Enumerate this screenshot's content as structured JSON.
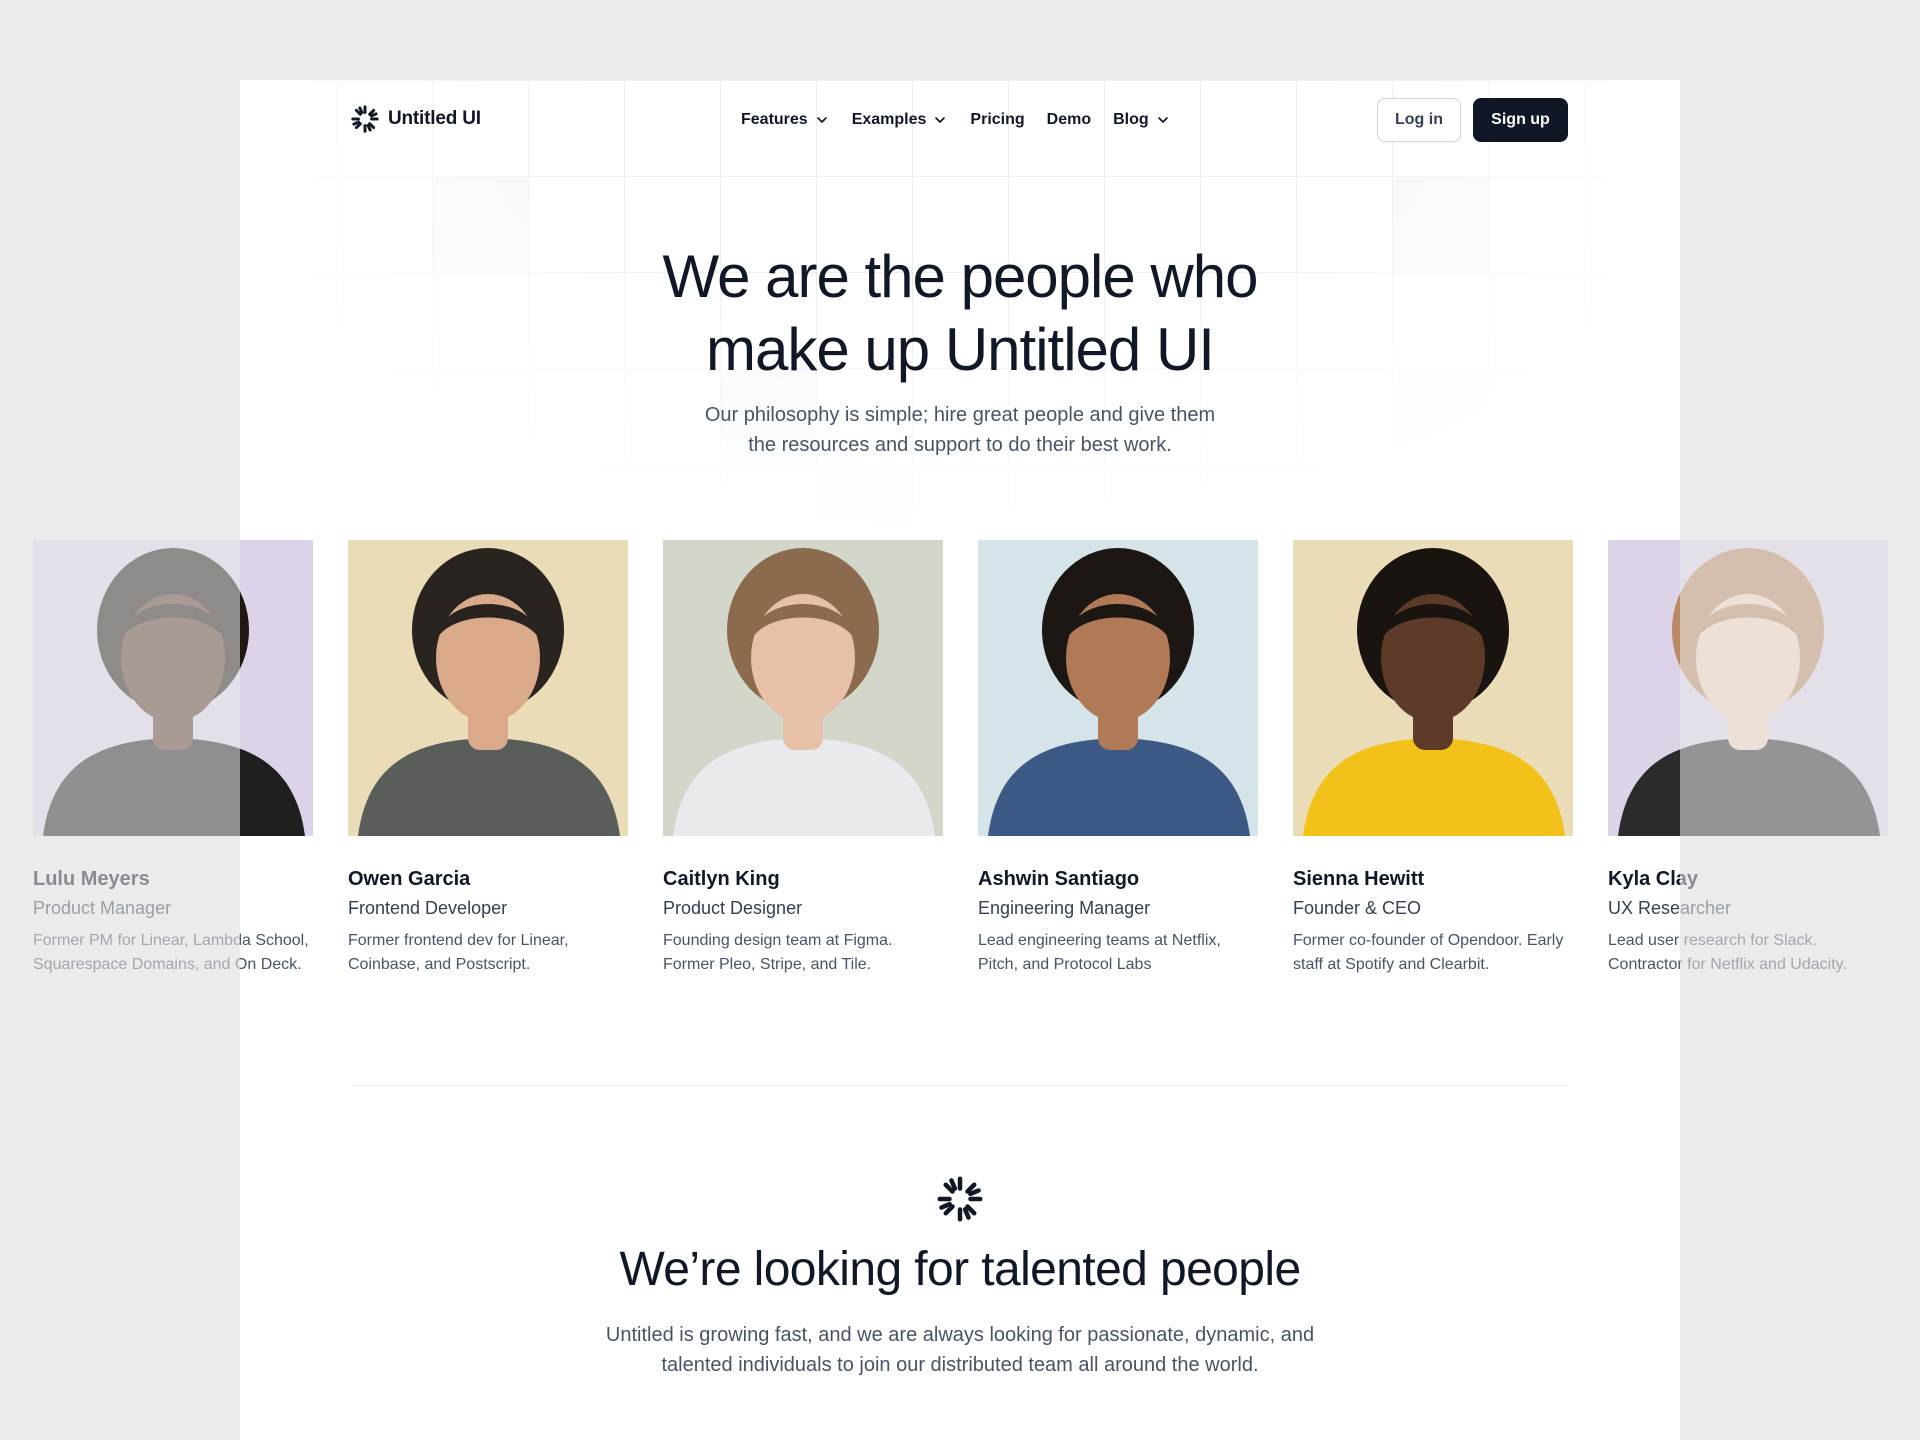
{
  "brand": {
    "name": "Untitled UI"
  },
  "nav": {
    "items": [
      {
        "label": "Features",
        "has_dropdown": true
      },
      {
        "label": "Examples",
        "has_dropdown": true
      },
      {
        "label": "Pricing",
        "has_dropdown": false
      },
      {
        "label": "Demo",
        "has_dropdown": false
      },
      {
        "label": "Blog",
        "has_dropdown": true
      }
    ],
    "login_label": "Log in",
    "signup_label": "Sign up"
  },
  "hero": {
    "title_line1": "We are the people who",
    "title_line2": "make up Untitled UI",
    "subtitle_line1": "Our philosophy is simple; hire great people and give them",
    "subtitle_line2": "the resources and support to do their best work."
  },
  "team": [
    {
      "name": "Lulu Meyers",
      "role": "Product Manager",
      "bio": "Former PM for Linear, Lambda School, Squarespace Domains, and On Deck.",
      "bg": "#dcd3e8",
      "skin": "#5a3a2a",
      "hair": "#1f1712",
      "shirt": "#1f1f1f"
    },
    {
      "name": "Owen Garcia",
      "role": "Frontend Developer",
      "bio": "Former frontend dev for Linear, Coinbase, and Postscript.",
      "bg": "#ebdcb8",
      "skin": "#d9a98a",
      "hair": "#2a2420",
      "shirt": "#5a5e5a"
    },
    {
      "name": "Caitlyn King",
      "role": "Product Designer",
      "bio": "Founding design team at Figma. Former Pleo, Stripe, and Tile.",
      "bg": "#d3d7c9",
      "skin": "#e6c1a7",
      "hair": "#8b6a4e",
      "shirt": "#e8eaee"
    },
    {
      "name": "Ashwin Santiago",
      "role": "Engineering Manager",
      "bio": "Lead engineering teams at Netflix, Pitch, and Protocol Labs",
      "bg": "#d5e4e8",
      "skin": "#b07a57",
      "hair": "#1d1714",
      "shirt": "#3d5a87"
    },
    {
      "name": "Sienna Hewitt",
      "role": "Founder & CEO",
      "bio": "Former co-founder of Opendoor. Early staff at Spotify and Clearbit.",
      "bg": "#ebdcb8",
      "skin": "#5e3a28",
      "hair": "#1a1411",
      "shirt": "#f2c21b"
    },
    {
      "name": "Kyla Clay",
      "role": "UX Researcher",
      "bio": "Lead user research for Slack. Contractor for Netflix and Udacity.",
      "bg": "#dcd3e8",
      "skin": "#f0d2bd",
      "hair": "#b98a64",
      "shirt": "#2b2b2b"
    }
  ],
  "careers": {
    "title": "We’re looking for talented people",
    "subtitle_line1": "Untitled is growing fast, and we are always looking for passionate, dynamic, and",
    "subtitle_line2": "talented individuals to join our distributed team all around the world."
  }
}
